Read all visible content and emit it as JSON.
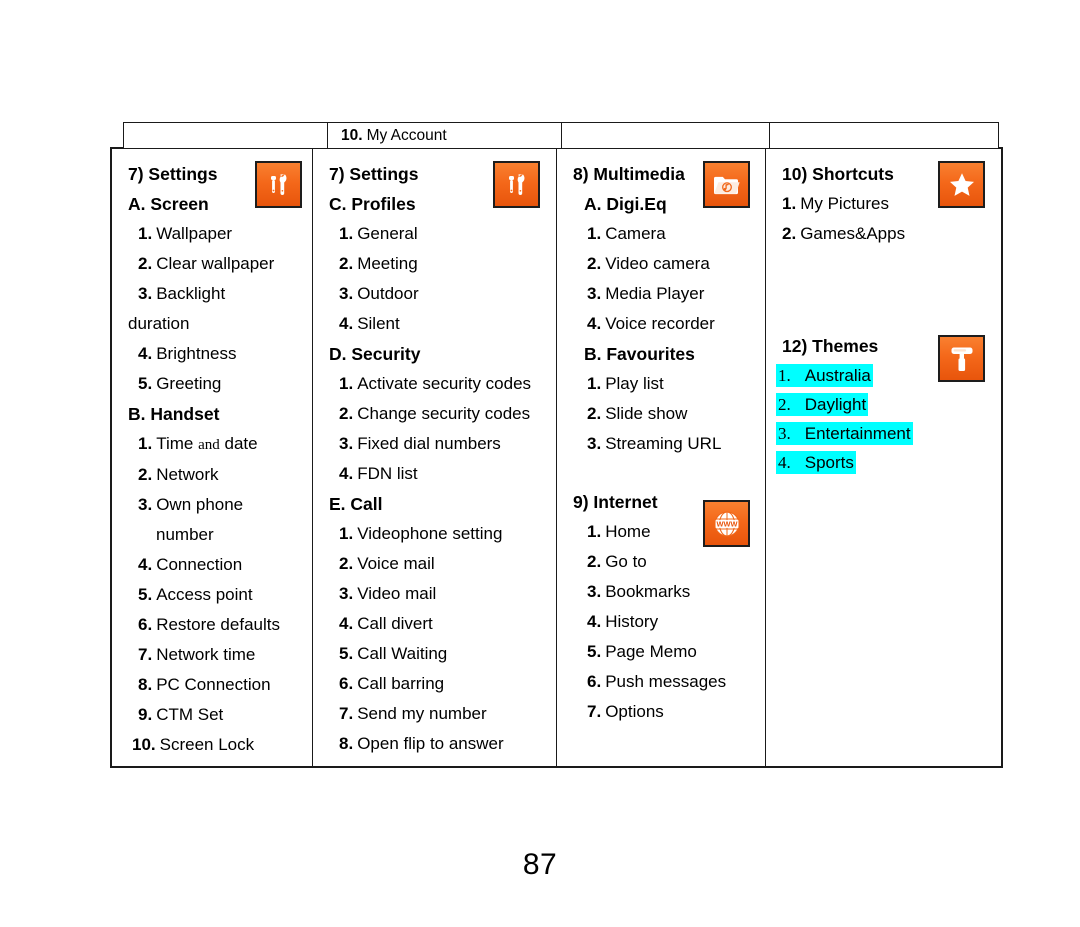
{
  "page": {
    "number": "87"
  },
  "header": {
    "cells": [
      {
        "num": "",
        "text": ""
      },
      {
        "num": "10.",
        "text": "My Account"
      },
      {
        "num": "",
        "text": ""
      },
      {
        "num": "",
        "text": ""
      }
    ]
  },
  "columns": [
    {
      "id": "column-settings-screen-handset",
      "icon": "tools-icon",
      "title": "7) Settings",
      "sections": [
        {
          "heading": "A. Screen",
          "items": [
            {
              "num": "1.",
              "label": "Wallpaper"
            },
            {
              "num": "2.",
              "label": "Clear wallpaper"
            },
            {
              "num": "3.",
              "label": "Backlight"
            },
            {
              "num": "",
              "label": "duration",
              "continuation": true
            },
            {
              "num": "4.",
              "label": "Brightness"
            },
            {
              "num": "5.",
              "label": "Greeting"
            }
          ]
        },
        {
          "heading": "B. Handset",
          "items": [
            {
              "num": "1.",
              "label": "Time and date",
              "label_pre": "Time",
              "label_mid": "and",
              "label_post": "date",
              "serif_mid": true
            },
            {
              "num": "2.",
              "label": "Network"
            },
            {
              "num": "3.",
              "label": "Own  phone"
            },
            {
              "num": "",
              "label": "number",
              "continuation": true
            },
            {
              "num": "4.",
              "label": "Connection"
            },
            {
              "num": "5.",
              "label": "Access point"
            },
            {
              "num": "6.",
              "label": "Restore defaults"
            },
            {
              "num": "7.",
              "label": "Network time"
            },
            {
              "num": "8.",
              "label": "PC Connection"
            },
            {
              "num": "9.",
              "label": "CTM Set"
            },
            {
              "num": "10.",
              "label": "Screen Lock"
            }
          ]
        }
      ]
    },
    {
      "id": "column-settings-profiles-security-call",
      "icon": "tools-icon",
      "title": "7) Settings",
      "sections": [
        {
          "heading": "C. Profiles",
          "items": [
            {
              "num": "1.",
              "label": "General"
            },
            {
              "num": "2.",
              "label": "Meeting"
            },
            {
              "num": "3.",
              "label": "Outdoor"
            },
            {
              "num": "4.",
              "label": "Silent"
            }
          ]
        },
        {
          "heading": "D. Security",
          "items": [
            {
              "num": "1.",
              "label": "Activate security codes"
            },
            {
              "num": "2.",
              "label": "Change security codes"
            },
            {
              "num": "3.",
              "label": "Fixed dial numbers"
            },
            {
              "num": "4.",
              "label": "FDN list"
            }
          ]
        },
        {
          "heading": "E. Call",
          "items": [
            {
              "num": "1.",
              "label": "Videophone setting"
            },
            {
              "num": "2.",
              "label": "Voice mail"
            },
            {
              "num": "3.",
              "label": "Video mail"
            },
            {
              "num": "4.",
              "label": "Call divert"
            },
            {
              "num": "5.",
              "label": "Call Waiting"
            },
            {
              "num": "6.",
              "label": "Call barring"
            },
            {
              "num": "7.",
              "label": "Send my number"
            },
            {
              "num": "8.",
              "label": "Open flip to answer"
            }
          ]
        }
      ]
    },
    {
      "id": "column-multimedia-internet",
      "groups": [
        {
          "icon": "media-folder-icon",
          "title": "8) Multimedia",
          "sections": [
            {
              "heading": "A. Digi.Eq",
              "items": [
                {
                  "num": "1.",
                  "label": "Camera"
                },
                {
                  "num": "2.",
                  "label": "Video camera"
                },
                {
                  "num": "3.",
                  "label": "Media Player"
                },
                {
                  "num": "4.",
                  "label": "Voice recorder"
                }
              ]
            },
            {
              "heading": "B. Favourites",
              "items": [
                {
                  "num": "1.",
                  "label": "Play list"
                },
                {
                  "num": "2.",
                  "label": "Slide show"
                },
                {
                  "num": "3.",
                  "label": "Streaming URL"
                }
              ]
            }
          ]
        },
        {
          "icon": "www-globe-icon",
          "title": "9) Internet",
          "sections": [
            {
              "heading": "",
              "items": [
                {
                  "num": "1.",
                  "label": "Home"
                },
                {
                  "num": "2.",
                  "label": "Go to"
                },
                {
                  "num": "3.",
                  "label": "Bookmarks"
                },
                {
                  "num": "4.",
                  "label": "History"
                },
                {
                  "num": "5.",
                  "label": "Page Memo"
                },
                {
                  "num": "6.",
                  "label": "Push messages"
                },
                {
                  "num": "7.",
                  "label": "Options"
                }
              ]
            }
          ]
        }
      ]
    },
    {
      "id": "column-shortcuts-themes",
      "groups": [
        {
          "icon": "star-icon",
          "title": "10) Shortcuts",
          "sections": [
            {
              "heading": "",
              "items": [
                {
                  "num": "1.",
                  "label": "My Pictures"
                },
                {
                  "num": "2.",
                  "label": "Games&Apps"
                }
              ]
            }
          ]
        },
        {
          "icon": "paint-roller-icon",
          "title": "12) Themes",
          "highlighted": true,
          "highlight_color": "#00ffff",
          "sections": [
            {
              "heading": "",
              "items": [
                {
                  "num": "1.",
                  "label": "Australia"
                },
                {
                  "num": "2.",
                  "label": "Daylight"
                },
                {
                  "num": "3.",
                  "label": "Entertainment"
                },
                {
                  "num": "4.",
                  "label": "Sports"
                }
              ]
            }
          ]
        }
      ]
    }
  ]
}
